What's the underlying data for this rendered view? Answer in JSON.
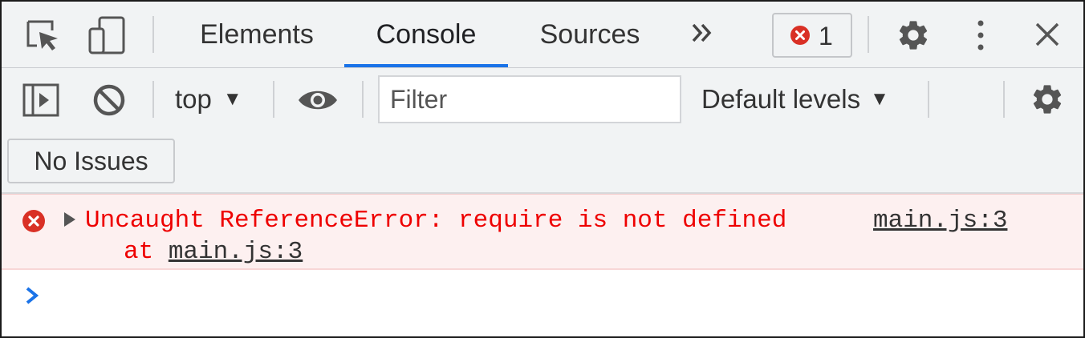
{
  "tabs": [
    {
      "label": "Elements",
      "active": false
    },
    {
      "label": "Console",
      "active": true
    },
    {
      "label": "Sources",
      "active": false
    }
  ],
  "tabbar": {
    "more_icon": "chevrons-right-icon",
    "error_count": "1"
  },
  "toolbar": {
    "context": "top",
    "filter_placeholder": "Filter",
    "levels": "Default levels"
  },
  "issues": {
    "label": "No Issues"
  },
  "console": {
    "messages": [
      {
        "level": "error",
        "text": "Uncaught ReferenceError: require is not defined",
        "stack_prefix": "at ",
        "stack_location": "main.js:3",
        "source": "main.js:3"
      }
    ]
  },
  "colors": {
    "accent": "#1a73e8",
    "error_text": "#ee0000",
    "error_bg": "#fdf0f0",
    "error_icon": "#d93025",
    "toolbar_bg": "#f1f3f4"
  }
}
